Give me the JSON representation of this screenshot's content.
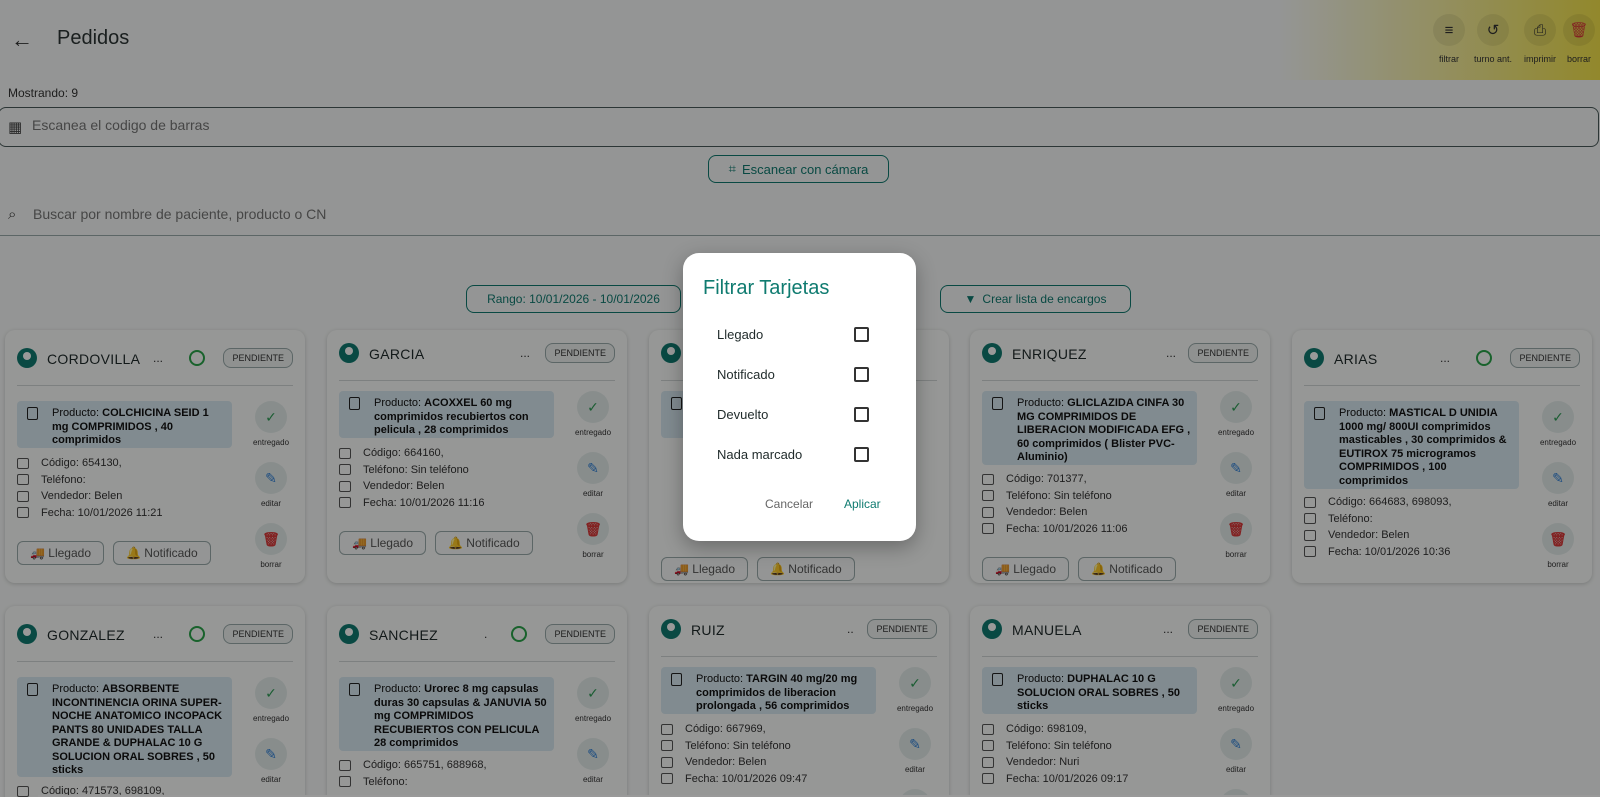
{
  "appbar": {
    "back_icon": "arrow-left-icon",
    "title": "Pedidos",
    "actions": [
      {
        "icon": "filter-icon",
        "label": "filtrar"
      },
      {
        "icon": "history-icon",
        "label": "turno ant."
      },
      {
        "icon": "print-icon",
        "label": "imprimir"
      },
      {
        "icon": "trash-icon",
        "label": "borrar"
      }
    ]
  },
  "showing": "Mostrando: 9",
  "scan": {
    "placeholder": "Escanea el codigo de barras",
    "camera_button": "Escanear con cámara"
  },
  "search": {
    "placeholder": "Buscar por nombre de paciente, producto o CN"
  },
  "filters": {
    "range": "Rango: 10/01/2026 - 10/01/2026",
    "create_list": "Crear lista de encargos"
  },
  "labels": {
    "product": "Producto:",
    "delivered": "entregado",
    "edit": "editar",
    "delete": "borrar",
    "arrived": "Llegado",
    "notified": "Notificado"
  },
  "cards": [
    {
      "name": "CORDOVILLA",
      "dots": "...",
      "status": "PENDIENTE",
      "product": "COLCHICINA SEID 1 mg COMPRIMIDOS , 40 comprimidos",
      "code": "Código: 654130,",
      "phone": "Teléfono:",
      "seller": "Vendedor: Belen",
      "date": "Fecha: 10/01/2026 11:21"
    },
    {
      "name": "GARCIA",
      "dots": "...",
      "status": "PENDIENTE",
      "product": "ACOXXEL 60 mg comprimidos recubiertos con pelicula , 28 comprimidos",
      "code": "Código: 664160,",
      "phone": "Teléfono: Sin teléfono",
      "seller": "Vendedor: Belen",
      "date": "Fecha: 10/01/2026 11:16"
    },
    {
      "name": "ENRIQUEZ",
      "dots": "...",
      "status": "PENDIENTE",
      "product": "GLICLAZIDA CINFA 30 MG COMPRIMIDOS DE LIBERACION MODIFICADA EFG , 60 comprimidos ( Blister PVC-Aluminio)",
      "code": "Código: 701377,",
      "phone": "Teléfono: Sin teléfono",
      "seller": "Vendedor: Belen",
      "date": "Fecha: 10/01/2026 11:06"
    },
    {
      "name": "ARIAS",
      "dots": "...",
      "status": "PENDIENTE",
      "product": "MASTICAL D UNIDIA 1000 mg/ 800UI comprimidos masticables , 30 comprimidos & EUTIROX 75 microgramos COMPRIMIDOS , 100 comprimidos",
      "code": "Código: 664683, 698093,",
      "phone": "Teléfono:",
      "seller": "Vendedor: Belen",
      "date": "Fecha: 10/01/2026 10:36"
    },
    {
      "name": "GONZALEZ",
      "dots": "...",
      "status": "PENDIENTE",
      "product": "ABSORBENTE INCONTINENCIA ORINA SUPER-NOCHE ANATOMICO INCOPACK PANTS 80 UNIDADES TALLA GRANDE & DUPHALAC 10 G SOLUCION ORAL SOBRES , 50 sticks",
      "code": "Código: 471573, 698109,"
    },
    {
      "name": "SANCHEZ",
      "dots": ".",
      "status": "PENDIENTE",
      "product": "Urorec 8 mg capsulas duras 30 capsulas & JANUVIA 50 mg COMPRIMIDOS RECUBIERTOS CON PELICULA 28 comprimidos",
      "code": "Código: 665751, 688968,",
      "phone": "Teléfono:"
    },
    {
      "name": "RUIZ",
      "dots": "..",
      "status": "PENDIENTE",
      "product": "TARGIN 40 mg/20 mg comprimidos de liberacion prolongada , 56 comprimidos",
      "code": "Código: 667969,",
      "phone": "Teléfono: Sin teléfono",
      "seller": "Vendedor: Belen",
      "date": "Fecha: 10/01/2026 09:47"
    },
    {
      "name": "MANUELA",
      "dots": "...",
      "status": "PENDIENTE",
      "product": "DUPHALAC 10 G SOLUCION ORAL SOBRES , 50 sticks",
      "code": "Código: 698109,",
      "phone": "Teléfono: Sin teléfono",
      "seller": "Vendedor: Nuri",
      "date": "Fecha: 10/01/2026 09:17"
    }
  ],
  "dialog": {
    "title": "Filtrar Tarjetas",
    "options": [
      {
        "label": "Llegado",
        "checked": false
      },
      {
        "label": "Notificado",
        "checked": false
      },
      {
        "label": "Devuelto",
        "checked": false
      },
      {
        "label": "Nada marcado",
        "checked": false
      }
    ],
    "cancel": "Cancelar",
    "apply": "Aplicar"
  },
  "colors": {
    "accent": "#0f7b70",
    "whatsapp": "#2aa44a",
    "delete": "#d93a3a",
    "edit": "#2f7fd6",
    "check": "#2e9c55"
  }
}
